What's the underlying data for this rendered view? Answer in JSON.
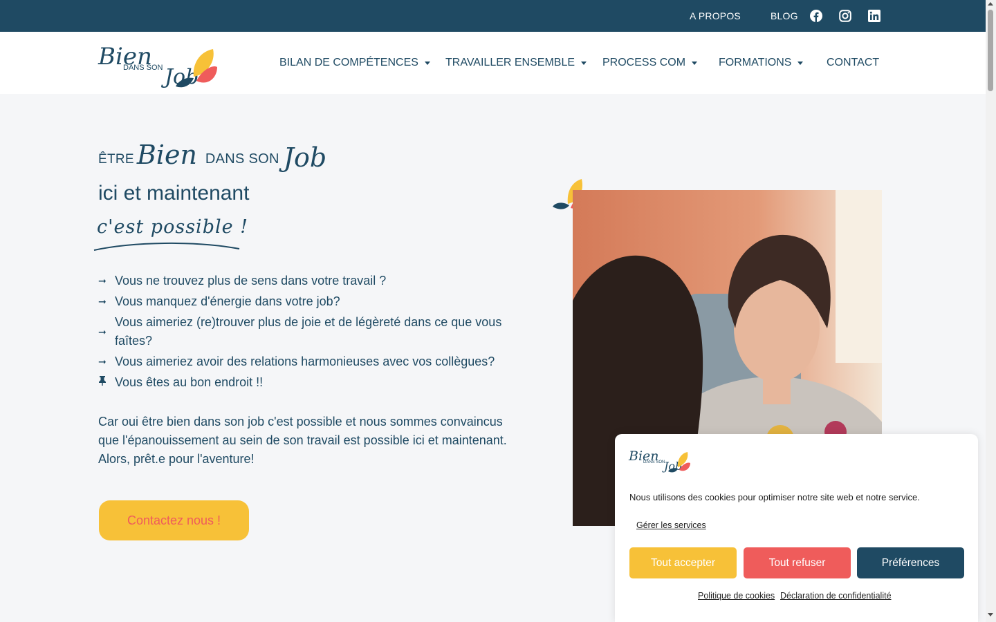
{
  "topbar": {
    "links": [
      "A PROPOS",
      "BLOG"
    ],
    "social_icons": [
      "facebook-icon",
      "instagram-icon",
      "linkedin-icon"
    ]
  },
  "logo": {
    "word1": "Bien",
    "word2": "DANS SON",
    "word3": "Job"
  },
  "nav": {
    "items": [
      {
        "label": "BILAN DE COMPÉTENCES",
        "dropdown": true
      },
      {
        "label": "TRAVAILLER ENSEMBLE",
        "dropdown": true
      },
      {
        "label": "PROCESS COM",
        "dropdown": true
      },
      {
        "label": "FORMATIONS",
        "dropdown": true
      },
      {
        "label": "CONTACT",
        "dropdown": false
      }
    ]
  },
  "hero": {
    "prefix": "ÊTRE",
    "script_bien": "Bien",
    "middle": "DANS SON",
    "script_job": "Job",
    "line2": "ici et maintenant",
    "line3": "c'est possible !",
    "bullets": [
      {
        "icon": "arrow-right-icon",
        "text": "Vous ne trouvez plus de sens dans votre travail ?"
      },
      {
        "icon": "arrow-right-icon",
        "text": "Vous manquez d'énergie dans votre job?"
      },
      {
        "icon": "arrow-right-icon",
        "text": "Vous aimeriez (re)trouver plus de joie et de légèreté dans ce que vous faîtes?"
      },
      {
        "icon": "arrow-right-icon",
        "text": "Vous aimeriez avoir des relations harmonieuses avec vos collègues?"
      },
      {
        "icon": "pushpin-icon",
        "text": "Vous êtes au bon endroit !!"
      }
    ],
    "paragraph1": "Car oui être bien dans son job c'est possible et nous sommes convaincus que l'épanouissement au sein de son travail est possible ici et maintenant.",
    "paragraph2": "Alors, prêt.e pour l'aventure!",
    "cta_label": "Contactez nous !"
  },
  "cookie": {
    "message": "Nous utilisons des cookies pour optimiser notre site web et notre service.",
    "manage": "Gérer les services",
    "accept": "Tout accepter",
    "refuse": "Tout refuser",
    "preferences": "Préférences",
    "policy": "Politique de cookies",
    "privacy": "Déclaration de confidentialité"
  },
  "colors": {
    "brand_navy": "#1f4a63",
    "brand_yellow": "#f7c138",
    "brand_coral": "#ef5c5b",
    "background": "#f5f6f8"
  }
}
